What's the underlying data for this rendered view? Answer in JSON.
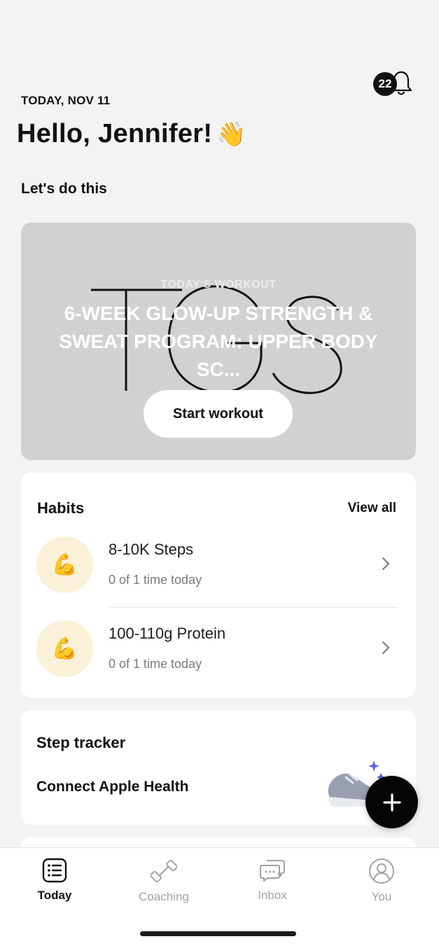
{
  "header": {
    "date": "TODAY, NOV 11",
    "notification_count": "22",
    "greeting": "Hello, Jennifer!",
    "greeting_emoji": "👋"
  },
  "section_title": "Let's do this",
  "workout": {
    "logo_text": "TGS",
    "eyebrow": "TODAY'S WORKOUT",
    "title": "6-WEEK GLOW-UP STRENGTH & SWEAT PROGRAM: UPPER BODY SC...",
    "start_label": "Start workout"
  },
  "habits": {
    "title": "Habits",
    "view_all": "View all",
    "items": [
      {
        "icon": "💪",
        "name": "8-10K Steps",
        "progress": "0 of 1 time today"
      },
      {
        "icon": "💪",
        "name": "100-110g Protein",
        "progress": "0 of 1 time today"
      }
    ]
  },
  "step_tracker": {
    "title": "Step tracker",
    "connect_label": "Connect Apple Health"
  },
  "fab": {
    "icon": "plus-icon"
  },
  "tabs": [
    {
      "label": "Today",
      "icon": "today-list-icon",
      "active": true
    },
    {
      "label": "Coaching",
      "icon": "dumbbell-icon",
      "active": false
    },
    {
      "label": "Inbox",
      "icon": "chat-bubbles-icon",
      "active": false
    },
    {
      "label": "You",
      "icon": "profile-icon",
      "active": false
    }
  ],
  "colors": {
    "background": "#f3f3f3",
    "workout_card": "#d1d1d1",
    "habit_avatar": "#fbf0d8",
    "fab": "#050505",
    "inactive_tab": "#a3a3a3"
  }
}
